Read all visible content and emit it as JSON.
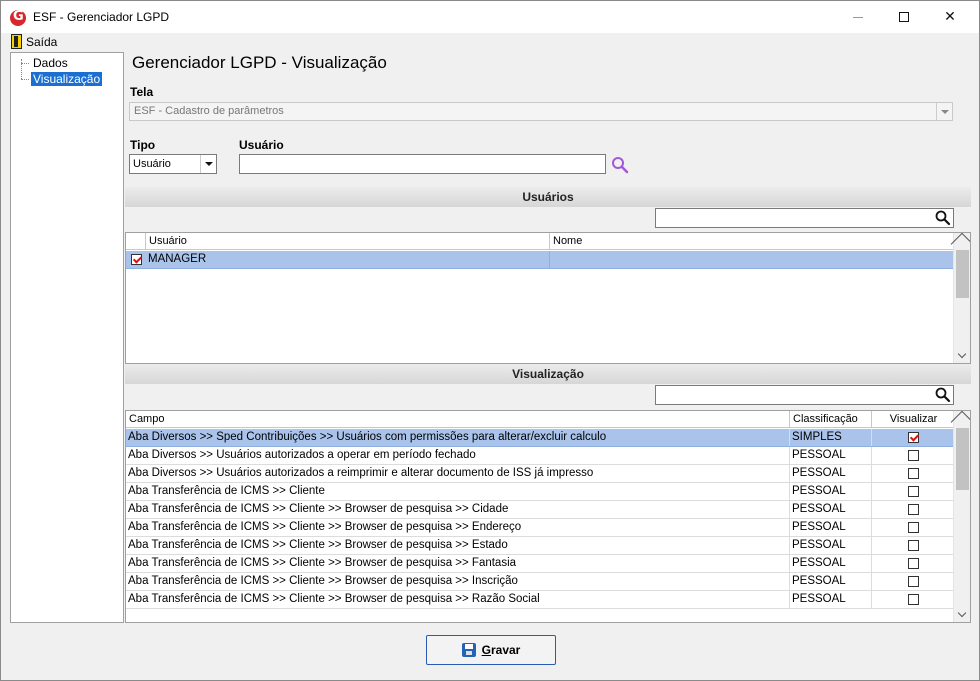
{
  "window": {
    "title": "ESF - Gerenciador LGPD",
    "min_icon": "minimize-icon",
    "max_icon": "maximize-icon",
    "close_icon": "close-icon",
    "close_glyph": "✕"
  },
  "menu": {
    "exit_label": "Saída"
  },
  "tree": {
    "items": [
      {
        "label": "Dados"
      },
      {
        "label": "Visualização",
        "selected": true
      }
    ]
  },
  "main": {
    "title": "Gerenciador LGPD - Visualização",
    "tela_label": "Tela",
    "tela_value": "ESF - Cadastro de parâmetros",
    "tipo_label": "Tipo",
    "tipo_value": "Usuário",
    "usuario_label": "Usuário",
    "usuario_value": ""
  },
  "users_section": {
    "header": "Usuários",
    "filter_value": "",
    "columns": [
      "Usuário",
      "Nome"
    ],
    "rows": [
      {
        "checked": true,
        "usuario": "MANAGER",
        "nome": ""
      }
    ]
  },
  "view_section": {
    "header": "Visualização",
    "filter_value": "",
    "columns": [
      "Campo",
      "Classificação",
      "Visualizar"
    ],
    "rows": [
      {
        "campo": "Aba Diversos >> Sped Contribuições >> Usuários com permissões para alterar/excluir calculo",
        "classificacao": "SIMPLES",
        "visualizar": true
      },
      {
        "campo": "Aba Diversos >> Usuários autorizados a operar em período fechado",
        "classificacao": "PESSOAL",
        "visualizar": false
      },
      {
        "campo": "Aba Diversos >> Usuários autorizados a reimprimir e alterar documento de ISS já impresso",
        "classificacao": "PESSOAL",
        "visualizar": false
      },
      {
        "campo": "Aba Transferência de ICMS >> Cliente",
        "classificacao": "PESSOAL",
        "visualizar": false
      },
      {
        "campo": "Aba Transferência de ICMS >> Cliente >> Browser de pesquisa >> Cidade",
        "classificacao": "PESSOAL",
        "visualizar": false
      },
      {
        "campo": "Aba Transferência de ICMS >> Cliente >> Browser de pesquisa >> Endereço",
        "classificacao": "PESSOAL",
        "visualizar": false
      },
      {
        "campo": "Aba Transferência de ICMS >> Cliente >> Browser de pesquisa >> Estado",
        "classificacao": "PESSOAL",
        "visualizar": false
      },
      {
        "campo": "Aba Transferência de ICMS >> Cliente >> Browser de pesquisa >> Fantasia",
        "classificacao": "PESSOAL",
        "visualizar": false
      },
      {
        "campo": "Aba Transferência de ICMS >> Cliente >> Browser de pesquisa >> Inscrição",
        "classificacao": "PESSOAL",
        "visualizar": false
      },
      {
        "campo": "Aba Transferência de ICMS >> Cliente >> Browser de pesquisa >> Razão Social",
        "classificacao": "PESSOAL",
        "visualizar": false
      }
    ]
  },
  "footer": {
    "save_label_first": "G",
    "save_label_rest": "ravar"
  },
  "colors": {
    "selection": "#a9c3ea",
    "tree_selection": "#1a6fd0",
    "button_border": "#2a5bb3",
    "check_mark": "#dd1111"
  }
}
